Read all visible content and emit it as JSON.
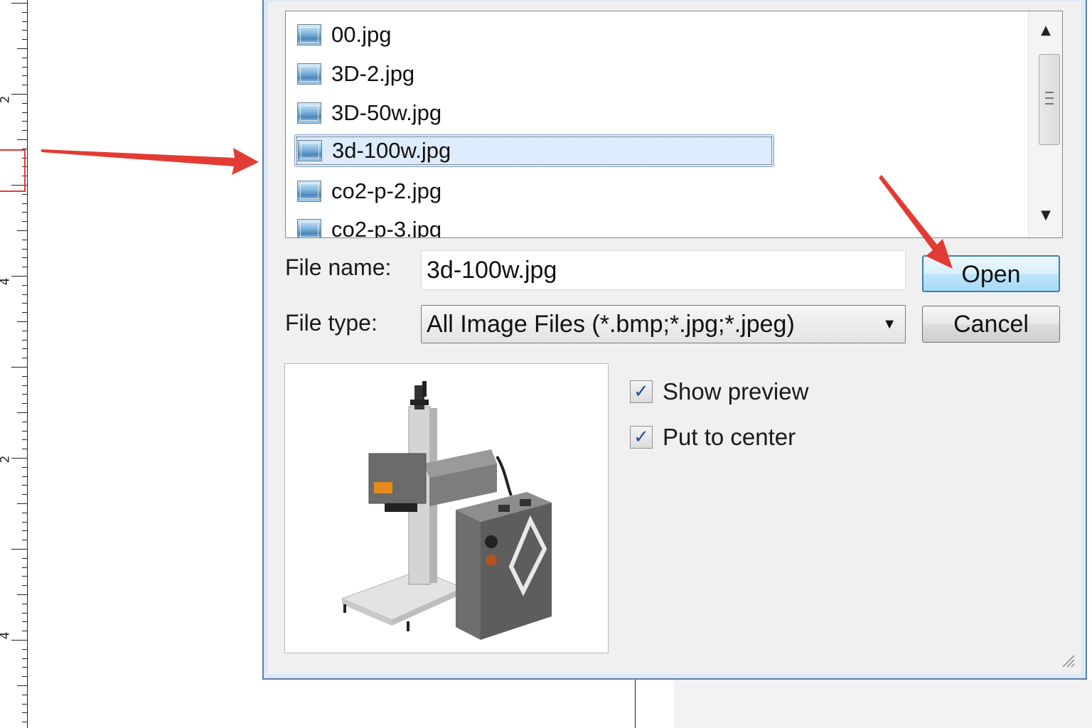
{
  "ruler": {
    "numbers": [
      "2",
      "4",
      "2",
      "4"
    ]
  },
  "file_list": {
    "items": [
      {
        "name": "00.jpg",
        "icon": "image-file-icon",
        "selected": false
      },
      {
        "name": "3D-2.jpg",
        "icon": "image-file-icon",
        "selected": false
      },
      {
        "name": "3D-50w.jpg",
        "icon": "image-file-icon",
        "selected": false
      },
      {
        "name": "3d-100w.jpg",
        "icon": "image-file-icon",
        "selected": true
      },
      {
        "name": "co2-p-2.jpg",
        "icon": "image-file-icon",
        "selected": false
      },
      {
        "name": "co2-p-3.jpg",
        "icon": "image-file-icon",
        "selected": false
      }
    ]
  },
  "form": {
    "file_name_label": "File name:",
    "file_name_value": "3d-100w.jpg",
    "file_type_label": "File type:",
    "file_type_value": "All Image Files (*.bmp;*.jpg;*.jpeg)"
  },
  "buttons": {
    "open": "Open",
    "cancel": "Cancel"
  },
  "options": {
    "show_preview": {
      "label": "Show preview",
      "checked": true
    },
    "put_to_center": {
      "label": "Put to center",
      "checked": true
    }
  },
  "colors": {
    "annotation_arrow": "#e23b33",
    "selection": "#ddecfc",
    "dialog_border": "#5b7fa8"
  }
}
